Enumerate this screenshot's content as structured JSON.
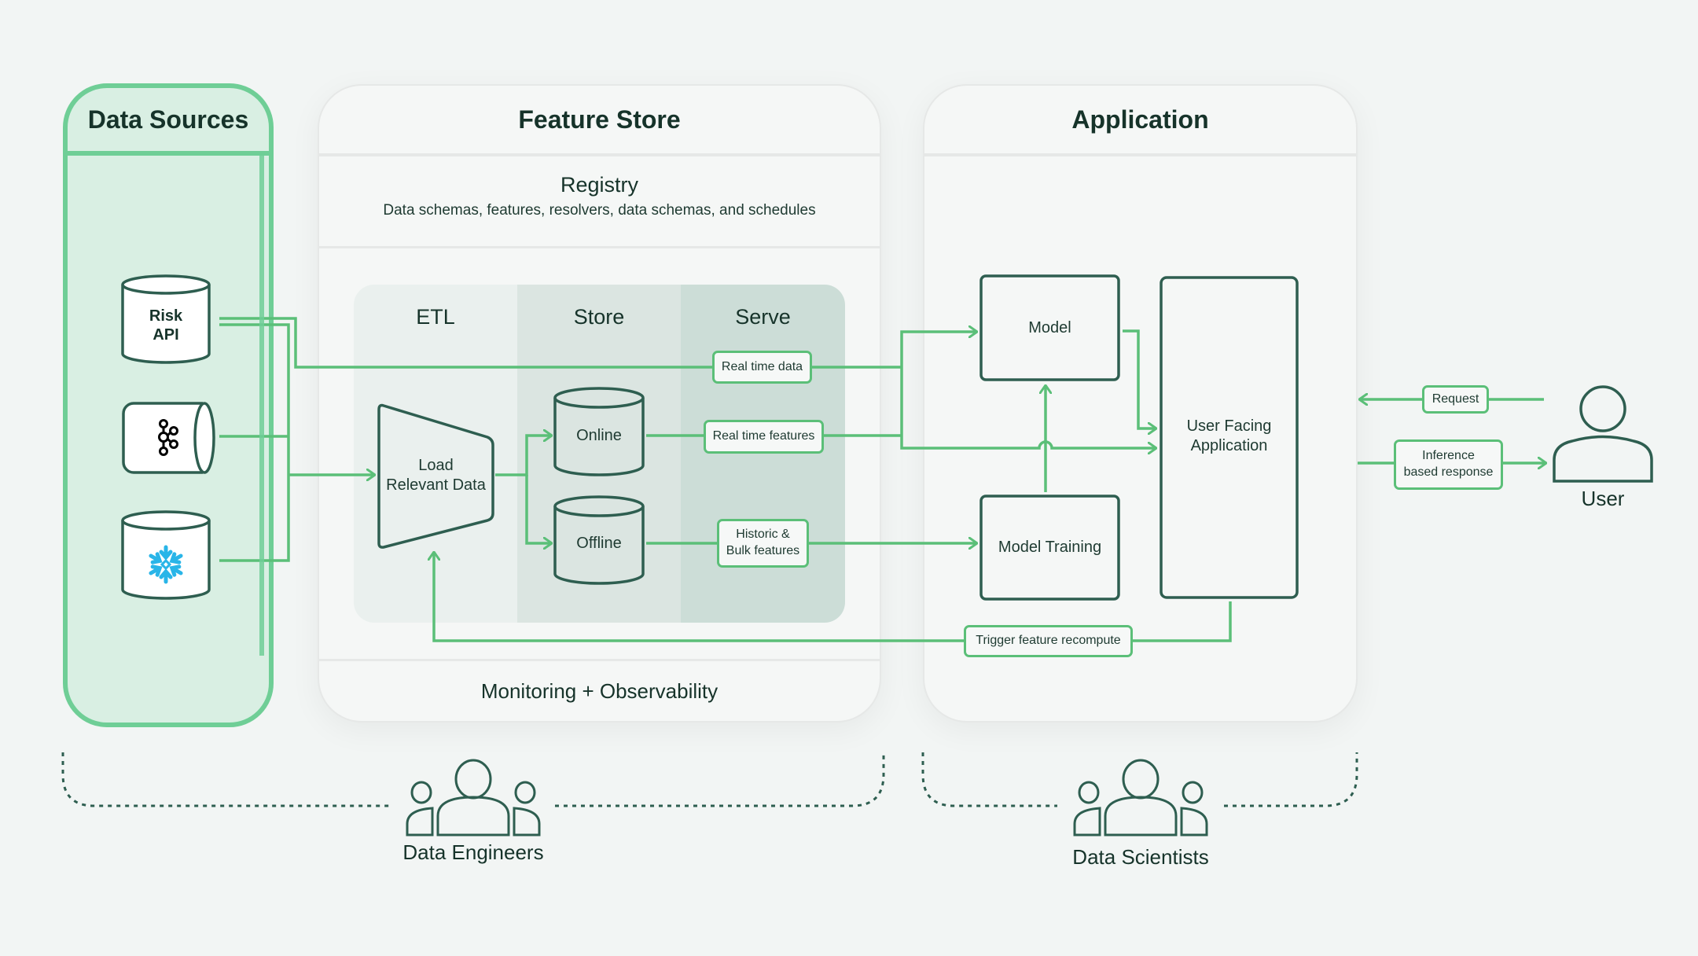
{
  "colors": {
    "background": "#f2f5f4",
    "accent_green": "#5bbf78",
    "source_green": "#6fce96",
    "source_fill": "#d9efe3",
    "outline_dark": "#2e5e50",
    "text_dark": "#16332a",
    "etl_col": "#eaf0ee",
    "store_col": "#dbe5e1",
    "serve_col": "#ccddd7",
    "snowflake_blue": "#29b5e8"
  },
  "data_sources": {
    "title": "Data Sources",
    "items": [
      {
        "label_line1": "Risk",
        "label_line2": "API",
        "icon": "database-icon"
      },
      {
        "label": "",
        "icon": "kafka-icon"
      },
      {
        "label": "",
        "icon": "snowflake-icon"
      }
    ]
  },
  "feature_store": {
    "title": "Feature Store",
    "registry": {
      "title": "Registry",
      "subtitle": "Data schemas, features, resolvers, data schemas, and schedules"
    },
    "columns": [
      "ETL",
      "Store",
      "Serve"
    ],
    "etl_node": {
      "line1": "Load",
      "line2": "Relevant Data"
    },
    "stores": [
      "Online",
      "Offline"
    ],
    "serve_labels": {
      "real_time_data": "Real time data",
      "real_time_features": "Real time features",
      "historic_line1": "Historic &",
      "historic_line2": "Bulk features"
    },
    "footer": "Monitoring + Observability"
  },
  "application": {
    "title": "Application",
    "model": "Model",
    "model_training": "Model Training",
    "user_facing_line1": "User Facing",
    "user_facing_line2": "Application",
    "trigger_label": "Trigger feature recompute"
  },
  "user": {
    "label": "User",
    "request_label": "Request",
    "response_line1": "Inference",
    "response_line2": "based response"
  },
  "teams": [
    {
      "label": "Data Engineers"
    },
    {
      "label": "Data Scientists"
    }
  ]
}
